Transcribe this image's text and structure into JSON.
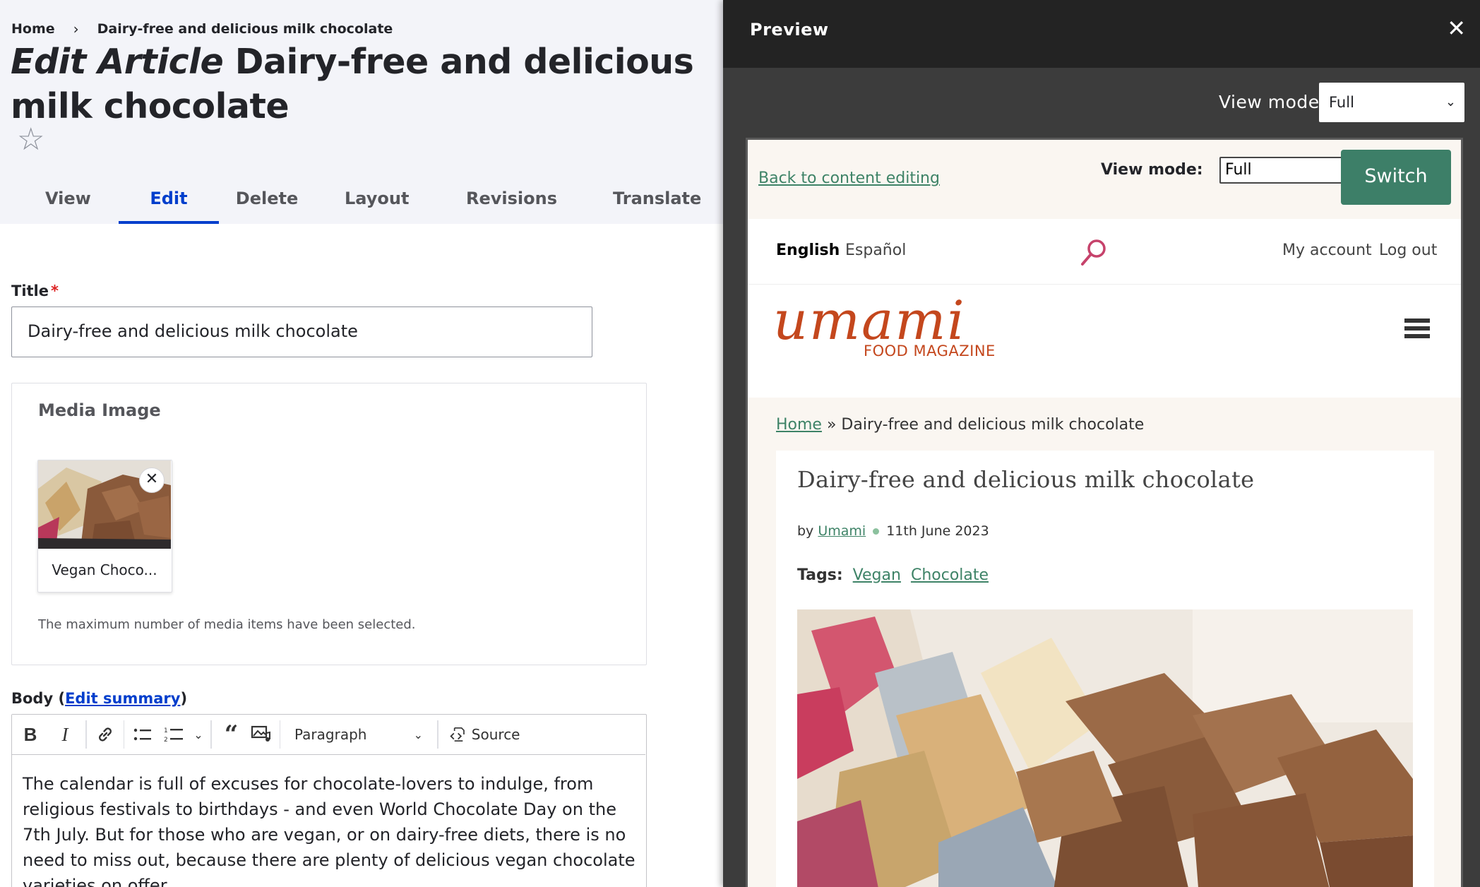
{
  "left": {
    "breadcrumb": {
      "home": "Home",
      "separator": "›",
      "current": "Dairy-free and delicious milk chocolate"
    },
    "page_title": {
      "prefix": "Edit Article",
      "rest": " Dairy-free and delicious milk chocolate"
    },
    "star_glyph": "☆",
    "tabs": [
      {
        "label": "View",
        "active": false
      },
      {
        "label": "Edit",
        "active": true
      },
      {
        "label": "Delete",
        "active": false
      },
      {
        "label": "Layout",
        "active": false
      },
      {
        "label": "Revisions",
        "active": false
      },
      {
        "label": "Translate",
        "active": false
      }
    ],
    "title_field": {
      "label": "Title",
      "required_mark": "*",
      "value": "Dairy-free and delicious milk chocolate"
    },
    "media": {
      "heading": "Media Image",
      "item_name": "Vegan Choco...",
      "remove_glyph": "✕",
      "note": "The maximum number of media items have been selected."
    },
    "body": {
      "label_prefix": "Body (",
      "edit_summary": "Edit summary",
      "label_suffix": ")",
      "toolbar": {
        "paragraph": "Paragraph",
        "source": "Source"
      },
      "text": "The calendar is full of excuses for chocolate-lovers to indulge, from religious festivals to birthdays - and even World Chocolate Day on the 7th July. But for those who are vegan, or on dairy-free diets, there is no need to miss out, because there are plenty of delicious vegan chocolate varieties on offer."
    }
  },
  "preview": {
    "title": "Preview",
    "close_glyph": "✕",
    "view_mode_label": "View mode",
    "view_mode_value": "Full",
    "frame": {
      "back_link": "Back to content editing",
      "view_mode_label": "View mode:",
      "view_mode_value": "Full",
      "switch_label": "Switch",
      "lang_en": "English",
      "lang_es": "Español",
      "my_account": "My account",
      "log_out": "Log out",
      "logo_word": "umami",
      "logo_sub": "FOOD MAGAZINE",
      "crumb_home": "Home",
      "crumb_sep": " » ",
      "crumb_current": "Dairy-free and delicious milk chocolate",
      "article_title": "Dairy-free and delicious milk chocolate",
      "by": "by ",
      "author": "Umami",
      "date": "11th June 2023",
      "tags_label": "Tags:",
      "tags": [
        "Vegan",
        "Chocolate"
      ]
    }
  },
  "colors": {
    "accent_blue": "#003ecc",
    "umami_green": "#3d7f68",
    "umami_orange": "#c4471d",
    "preview_dark": "#232323"
  }
}
